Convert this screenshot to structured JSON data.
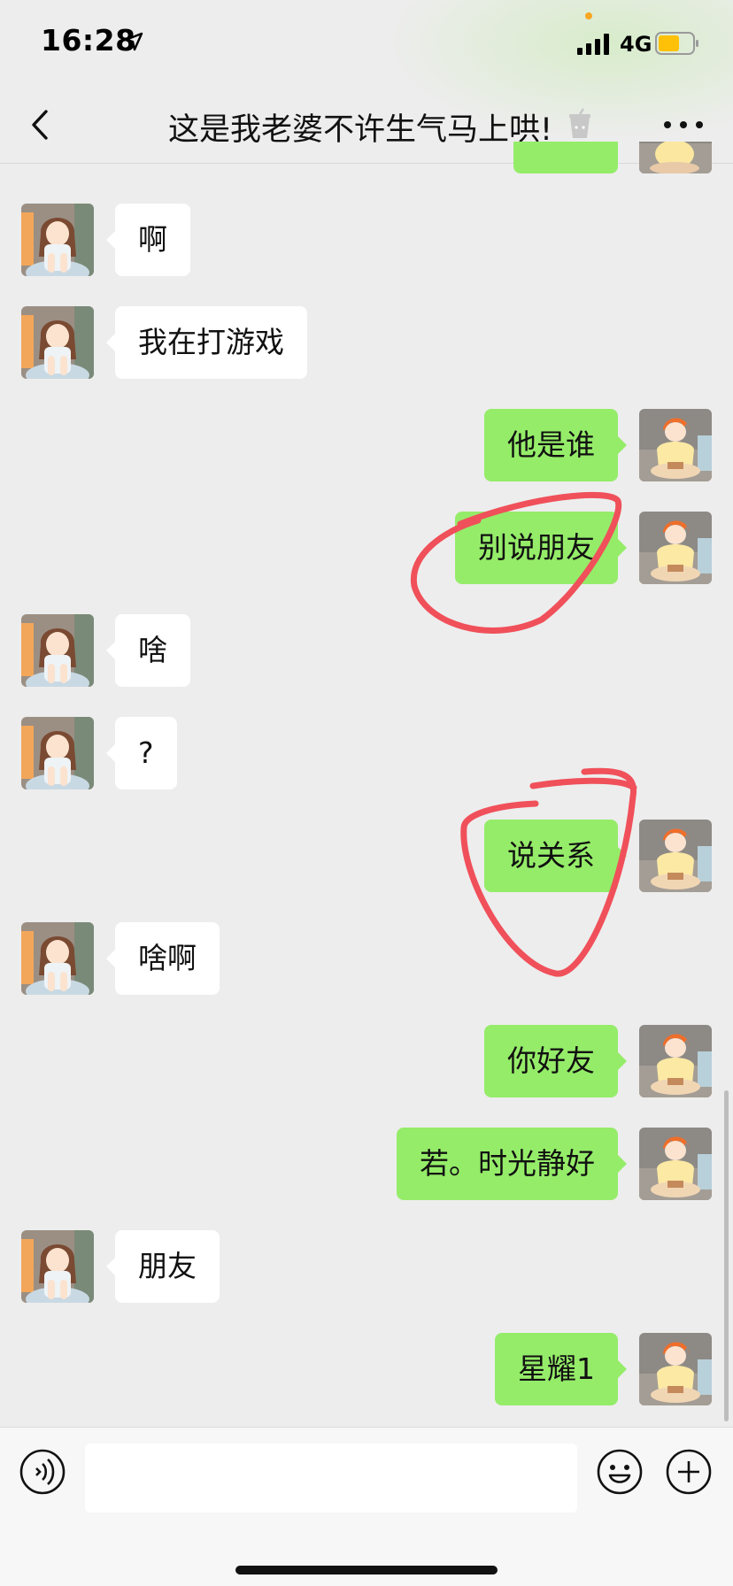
{
  "status_bar": {
    "time": "16:28",
    "network": "4G",
    "icons": [
      "location-arrow-icon",
      "signal-icon",
      "battery-icon"
    ],
    "battery_color": "#ffc107"
  },
  "header": {
    "title": "这是我老婆不许生气马上哄!",
    "back_icon": "chevron-left-icon",
    "title_icon": "cup-icon",
    "more_icon": "more-dots-icon"
  },
  "messages": [
    {
      "side": "left",
      "text": "啊"
    },
    {
      "side": "left",
      "text": "我在打游戏"
    },
    {
      "side": "right",
      "text": "他是谁"
    },
    {
      "side": "right",
      "text": "别说朋友"
    },
    {
      "side": "left",
      "text": "啥"
    },
    {
      "side": "left",
      "text": "?"
    },
    {
      "side": "right",
      "text": "说关系"
    },
    {
      "side": "left",
      "text": "啥啊"
    },
    {
      "side": "right",
      "text": "你好友"
    },
    {
      "side": "right",
      "text": "若。时光静好"
    },
    {
      "side": "left",
      "text": "朋友"
    },
    {
      "side": "right",
      "text": "星耀1"
    }
  ],
  "input_bar": {
    "placeholder": "",
    "icons": [
      "voice-icon",
      "emoji-icon",
      "plus-icon"
    ]
  },
  "colors": {
    "background": "#ededed",
    "sent_bubble": "#95ec69",
    "received_bubble": "#ffffff",
    "annotation_red": "#f0505a"
  }
}
